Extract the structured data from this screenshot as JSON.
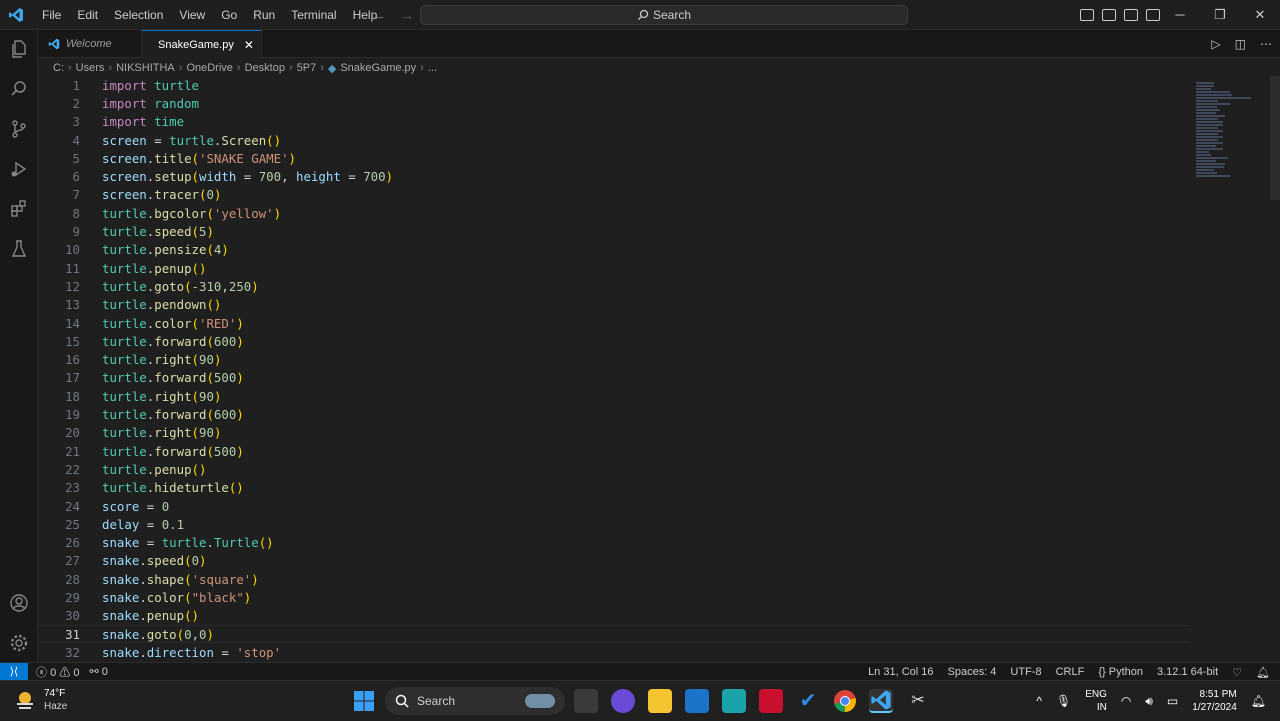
{
  "menu": [
    "File",
    "Edit",
    "Selection",
    "View",
    "Go",
    "Run",
    "Terminal",
    "Help"
  ],
  "command_center": {
    "label": "Search"
  },
  "tabs": [
    {
      "label": "Welcome",
      "active": false
    },
    {
      "label": "SnakeGame.py",
      "active": true
    }
  ],
  "breadcrumb": [
    "C:",
    "Users",
    "NIKSHITHA",
    "OneDrive",
    "Desktop",
    "5P7",
    "SnakeGame.py",
    "..."
  ],
  "editor": {
    "current_line": 31,
    "lines": [
      [
        [
          "kw",
          "import "
        ],
        [
          "cls",
          "turtle"
        ]
      ],
      [
        [
          "kw",
          "import "
        ],
        [
          "cls",
          "random"
        ]
      ],
      [
        [
          "kw",
          "import "
        ],
        [
          "cls",
          "time"
        ]
      ],
      [
        [
          "var",
          "screen"
        ],
        [
          "op",
          " = "
        ],
        [
          "cls",
          "turtle"
        ],
        [
          "op",
          "."
        ],
        [
          "fn",
          "Screen"
        ],
        [
          "par",
          "()"
        ]
      ],
      [
        [
          "var",
          "screen"
        ],
        [
          "op",
          "."
        ],
        [
          "fn",
          "title"
        ],
        [
          "par",
          "("
        ],
        [
          "str",
          "'SNAKE GAME'"
        ],
        [
          "par",
          ")"
        ]
      ],
      [
        [
          "var",
          "screen"
        ],
        [
          "op",
          "."
        ],
        [
          "fn",
          "setup"
        ],
        [
          "par",
          "("
        ],
        [
          "var",
          "width"
        ],
        [
          "op",
          " = "
        ],
        [
          "num",
          "700"
        ],
        [
          "op",
          ", "
        ],
        [
          "var",
          "height"
        ],
        [
          "op",
          " = "
        ],
        [
          "num",
          "700"
        ],
        [
          "par",
          ")"
        ]
      ],
      [
        [
          "var",
          "screen"
        ],
        [
          "op",
          "."
        ],
        [
          "fn",
          "tracer"
        ],
        [
          "par",
          "("
        ],
        [
          "num",
          "0"
        ],
        [
          "par",
          ")"
        ]
      ],
      [
        [
          "cls",
          "turtle"
        ],
        [
          "op",
          "."
        ],
        [
          "fn",
          "bgcolor"
        ],
        [
          "par",
          "("
        ],
        [
          "str",
          "'yellow'"
        ],
        [
          "par",
          ")"
        ]
      ],
      [
        [
          "cls",
          "turtle"
        ],
        [
          "op",
          "."
        ],
        [
          "fn",
          "speed"
        ],
        [
          "par",
          "("
        ],
        [
          "num",
          "5"
        ],
        [
          "par",
          ")"
        ]
      ],
      [
        [
          "cls",
          "turtle"
        ],
        [
          "op",
          "."
        ],
        [
          "fn",
          "pensize"
        ],
        [
          "par",
          "("
        ],
        [
          "num",
          "4"
        ],
        [
          "par",
          ")"
        ]
      ],
      [
        [
          "cls",
          "turtle"
        ],
        [
          "op",
          "."
        ],
        [
          "fn",
          "penup"
        ],
        [
          "par",
          "()"
        ]
      ],
      [
        [
          "cls",
          "turtle"
        ],
        [
          "op",
          "."
        ],
        [
          "fn",
          "goto"
        ],
        [
          "par",
          "("
        ],
        [
          "num",
          "-310"
        ],
        [
          "op",
          ","
        ],
        [
          "num",
          "250"
        ],
        [
          "par",
          ")"
        ]
      ],
      [
        [
          "cls",
          "turtle"
        ],
        [
          "op",
          "."
        ],
        [
          "fn",
          "pendown"
        ],
        [
          "par",
          "()"
        ]
      ],
      [
        [
          "cls",
          "turtle"
        ],
        [
          "op",
          "."
        ],
        [
          "fn",
          "color"
        ],
        [
          "par",
          "("
        ],
        [
          "str",
          "'RED'"
        ],
        [
          "par",
          ")"
        ]
      ],
      [
        [
          "cls",
          "turtle"
        ],
        [
          "op",
          "."
        ],
        [
          "fn",
          "forward"
        ],
        [
          "par",
          "("
        ],
        [
          "num",
          "600"
        ],
        [
          "par",
          ")"
        ]
      ],
      [
        [
          "cls",
          "turtle"
        ],
        [
          "op",
          "."
        ],
        [
          "fn",
          "right"
        ],
        [
          "par",
          "("
        ],
        [
          "num",
          "90"
        ],
        [
          "par",
          ")"
        ]
      ],
      [
        [
          "cls",
          "turtle"
        ],
        [
          "op",
          "."
        ],
        [
          "fn",
          "forward"
        ],
        [
          "par",
          "("
        ],
        [
          "num",
          "500"
        ],
        [
          "par",
          ")"
        ]
      ],
      [
        [
          "cls",
          "turtle"
        ],
        [
          "op",
          "."
        ],
        [
          "fn",
          "right"
        ],
        [
          "par",
          "("
        ],
        [
          "num",
          "90"
        ],
        [
          "par",
          ")"
        ]
      ],
      [
        [
          "cls",
          "turtle"
        ],
        [
          "op",
          "."
        ],
        [
          "fn",
          "forward"
        ],
        [
          "par",
          "("
        ],
        [
          "num",
          "600"
        ],
        [
          "par",
          ")"
        ]
      ],
      [
        [
          "cls",
          "turtle"
        ],
        [
          "op",
          "."
        ],
        [
          "fn",
          "right"
        ],
        [
          "par",
          "("
        ],
        [
          "num",
          "90"
        ],
        [
          "par",
          ")"
        ]
      ],
      [
        [
          "cls",
          "turtle"
        ],
        [
          "op",
          "."
        ],
        [
          "fn",
          "forward"
        ],
        [
          "par",
          "("
        ],
        [
          "num",
          "500"
        ],
        [
          "par",
          ")"
        ]
      ],
      [
        [
          "cls",
          "turtle"
        ],
        [
          "op",
          "."
        ],
        [
          "fn",
          "penup"
        ],
        [
          "par",
          "()"
        ]
      ],
      [
        [
          "cls",
          "turtle"
        ],
        [
          "op",
          "."
        ],
        [
          "fn",
          "hideturtle"
        ],
        [
          "par",
          "()"
        ]
      ],
      [
        [
          "var",
          "score"
        ],
        [
          "op",
          " = "
        ],
        [
          "num",
          "0"
        ]
      ],
      [
        [
          "var",
          "delay"
        ],
        [
          "op",
          " = "
        ],
        [
          "num",
          "0.1"
        ]
      ],
      [
        [
          "var",
          "snake"
        ],
        [
          "op",
          " = "
        ],
        [
          "cls",
          "turtle"
        ],
        [
          "op",
          "."
        ],
        [
          "cls",
          "Turtle"
        ],
        [
          "par",
          "()"
        ]
      ],
      [
        [
          "var",
          "snake"
        ],
        [
          "op",
          "."
        ],
        [
          "fn",
          "speed"
        ],
        [
          "par",
          "("
        ],
        [
          "num",
          "0"
        ],
        [
          "par",
          ")"
        ]
      ],
      [
        [
          "var",
          "snake"
        ],
        [
          "op",
          "."
        ],
        [
          "fn",
          "shape"
        ],
        [
          "par",
          "("
        ],
        [
          "str",
          "'square'"
        ],
        [
          "par",
          ")"
        ]
      ],
      [
        [
          "var",
          "snake"
        ],
        [
          "op",
          "."
        ],
        [
          "fn",
          "color"
        ],
        [
          "par",
          "("
        ],
        [
          "str",
          "\"black\""
        ],
        [
          "par",
          ")"
        ]
      ],
      [
        [
          "var",
          "snake"
        ],
        [
          "op",
          "."
        ],
        [
          "fn",
          "penup"
        ],
        [
          "par",
          "()"
        ]
      ],
      [
        [
          "var",
          "snake"
        ],
        [
          "op",
          "."
        ],
        [
          "fn",
          "goto"
        ],
        [
          "par",
          "("
        ],
        [
          "num",
          "0"
        ],
        [
          "op",
          ","
        ],
        [
          "num",
          "0"
        ],
        [
          "par",
          ")"
        ]
      ],
      [
        [
          "var",
          "snake"
        ],
        [
          "op",
          "."
        ],
        [
          "var",
          "direction"
        ],
        [
          "op",
          " = "
        ],
        [
          "str",
          "'stop'"
        ]
      ]
    ]
  },
  "statusbar": {
    "errors": "0",
    "warnings": "0",
    "ports": "0",
    "position": "Ln 31, Col 16",
    "spaces": "Spaces: 4",
    "encoding": "UTF-8",
    "eol": "CRLF",
    "language": "Python",
    "interpreter": "3.12.1 64-bit"
  },
  "taskbar": {
    "weather_temp": "74°F",
    "weather_desc": "Haze",
    "search_label": "Search",
    "lang_1": "ENG",
    "lang_2": "IN",
    "time": "8:51 PM",
    "date": "1/27/2024"
  },
  "colors": {
    "keyword": "#c586c0",
    "variable": "#9cdcfe",
    "function": "#dcdcaa",
    "class": "#4ec9b0",
    "string": "#ce9178",
    "number": "#b5cea8",
    "accent": "#0078d4"
  }
}
